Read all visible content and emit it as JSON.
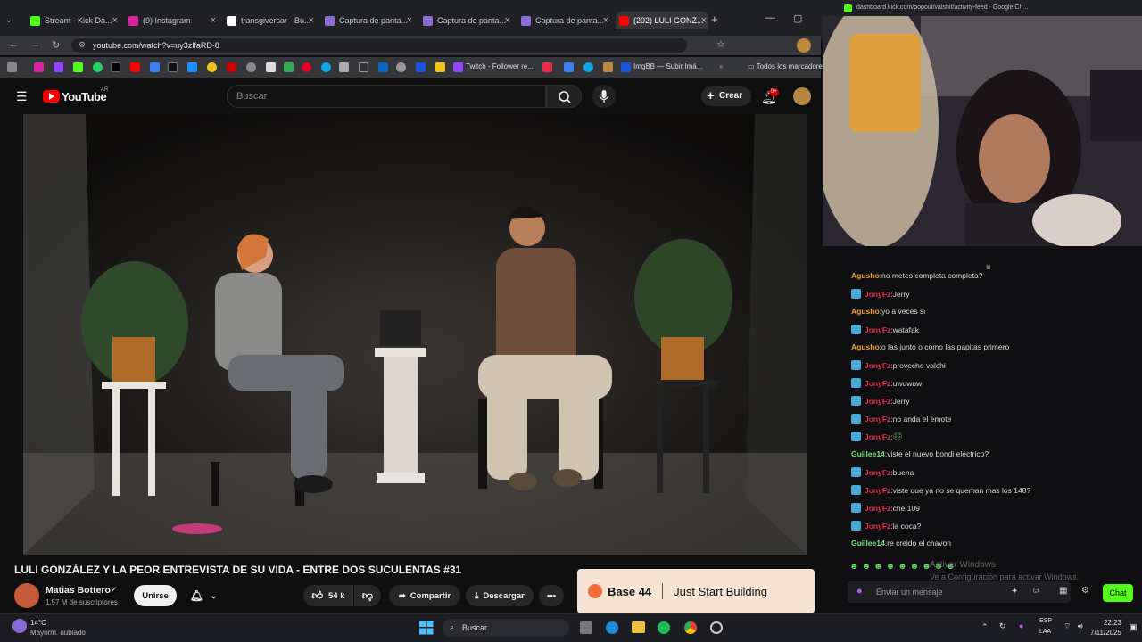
{
  "browser": {
    "tabs": [
      {
        "label": "Stream - Kick Da...",
        "color": "#53fc18"
      },
      {
        "label": "(9) Instagram",
        "color": "#d6249f"
      },
      {
        "label": "transgiversar - Bu...",
        "color": "#ffffff"
      },
      {
        "label": "Captura de panta...",
        "color": "#8e6bd6"
      },
      {
        "label": "Captura de panta...",
        "color": "#8e6bd6"
      },
      {
        "label": "Captura de panta...",
        "color": "#8e6bd6"
      },
      {
        "label": "(202) LULI GONZ...",
        "color": "#ff0000"
      }
    ],
    "url": "youtube.com/watch?v=uy3zlfaRD-8",
    "bookmark_twitch": "Twitch - Follower re...",
    "bookmark_imgbb": "ImgBB — Subir Imá...",
    "bookmark_all": "Todos los marcadores",
    "popup_url": "dashboard.kick.com/popout/valshit/activity-feed - Google Ch..."
  },
  "youtube": {
    "logo": "YouTube",
    "region": "AR",
    "search_placeholder": "Buscar",
    "create_label": "Crear",
    "notif_count": "9+",
    "video_title": "LULI GONZÁLEZ Y LA PEOR ENTREVISTA DE SU VIDA - ENTRE DOS SUCULENTAS #31",
    "channel": "Matias Bottero",
    "subscribers": "1.57 M de suscriptores",
    "join_label": "Unirse",
    "likes": "54 k",
    "share_label": "Compartir",
    "download_label": "Descargar"
  },
  "ad": {
    "brand": "Base 44",
    "tagline": "Just Start Building"
  },
  "chat": {
    "messages": [
      {
        "user": "Agusho",
        "text": "no metes completa completa?",
        "color": "#f0a030",
        "badge": false
      },
      {
        "user": "JonyFz",
        "text": "Jerry",
        "color": "#e8304a",
        "badge": true
      },
      {
        "user": "Agusho",
        "text": "yo a veces si",
        "color": "#f0a030",
        "badge": false
      },
      {
        "user": "JonyFz",
        "text": "watafak",
        "color": "#e8304a",
        "badge": true
      },
      {
        "user": "Agusho",
        "text": "o las junto o como las papitas primero",
        "color": "#f0a030",
        "badge": false
      },
      {
        "user": "JonyFz",
        "text": "provecho valchi",
        "color": "#e8304a",
        "badge": true
      },
      {
        "user": "JonyFz",
        "text": "uwuwuw",
        "color": "#e8304a",
        "badge": true
      },
      {
        "user": "JonyFz",
        "text": "Jerry",
        "color": "#e8304a",
        "badge": true
      },
      {
        "user": "JonyFz",
        "text": "no anda el emote",
        "color": "#e8304a",
        "badge": true
      },
      {
        "user": "JonyFz",
        "text": "",
        "color": "#e8304a",
        "badge": true
      },
      {
        "user": "Guillee14",
        "text": "viste el nuevo bondi eléctrico?",
        "color": "#7ee07e",
        "badge": false
      },
      {
        "user": "JonyFz",
        "text": "buena",
        "color": "#e8304a",
        "badge": true
      },
      {
        "user": "JonyFz",
        "text": "viste que ya no se queman mas los 148?",
        "color": "#e8304a",
        "badge": true
      },
      {
        "user": "JonyFz",
        "text": "che 109",
        "color": "#e8304a",
        "badge": true
      },
      {
        "user": "JonyFz",
        "text": "la coca?",
        "color": "#e8304a",
        "badge": true
      },
      {
        "user": "Guillee14",
        "text": "re creido el chavon",
        "color": "#7ee07e",
        "badge": false
      }
    ],
    "input_placeholder": "Enviar un mensaje",
    "send_label": "Chat",
    "windows_watermark_title": "Activar Windows",
    "windows_watermark_sub": "Ve a Configuración para activar Windows."
  },
  "taskbar": {
    "temp": "14°C",
    "weather": "Mayorm. nublado",
    "search": "Buscar",
    "lang1": "ESP",
    "lang2": "LAA",
    "time": "22:23",
    "date": "7/11/2025"
  }
}
